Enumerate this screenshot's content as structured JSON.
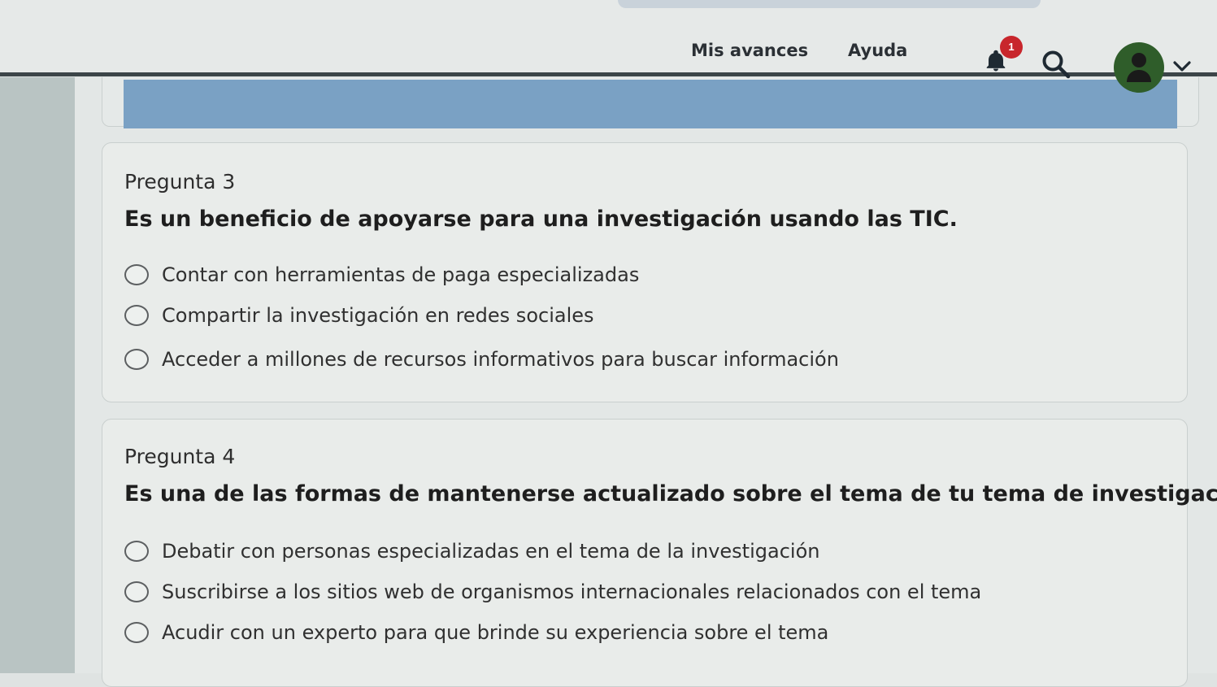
{
  "nav": {
    "links": [
      "Mis avances",
      "Ayuda"
    ],
    "notification_count": "1",
    "icons": [
      "bell-icon",
      "search-icon",
      "user-icon",
      "chevron-down-icon"
    ]
  },
  "questions": [
    {
      "number": "Pregunta 3",
      "text": "Es un beneficio de apoyarse para una investigación usando las TIC.",
      "options": [
        "Contar con herramientas de paga especializadas",
        "Compartir la investigación en redes sociales",
        "Acceder a millones de recursos informativos para buscar información"
      ]
    },
    {
      "number": "Pregunta 4",
      "text": "Es una de las formas de mantenerse actualizado sobre el tema de tu tema de investigación.",
      "options": [
        "Debatir con personas especializadas en el tema de la investigación",
        "Suscribirse a los sitios web de organismos internacionales relacionados con el tema",
        "Acudir con un experto para que brinde su experiencia sobre el tema"
      ]
    }
  ],
  "colors": {
    "badge": "#c8262c",
    "avatar": "#2f5d2a",
    "accent_bar": "#7aa1c4"
  }
}
